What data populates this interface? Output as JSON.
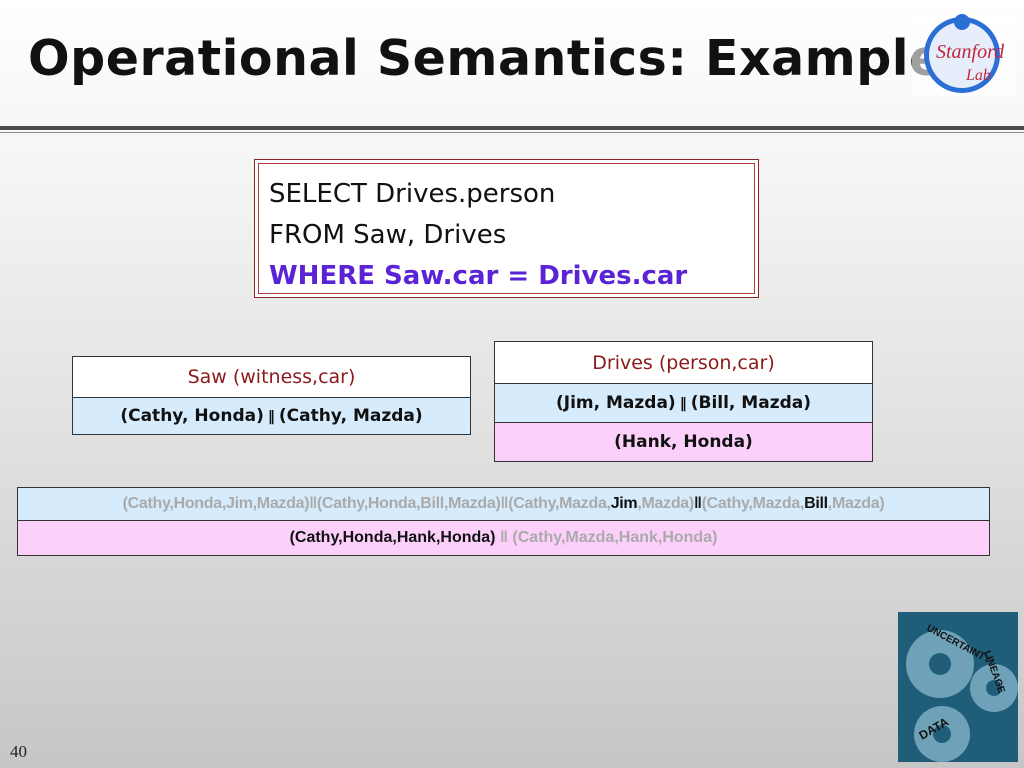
{
  "title": "Operational Semantics: Example",
  "logo": {
    "line1": "Stanford",
    "line2": "Lab"
  },
  "sql": {
    "line1": "SELECT Drives.person",
    "line2": "FROM Saw, Drives",
    "line3": "WHERE Saw.car = Drives.car"
  },
  "saw": {
    "header": "Saw (witness,car)",
    "row1_a": "(Cathy, Honda)",
    "row1_b": "(Cathy, Mazda)"
  },
  "drives": {
    "header": "Drives (person,car)",
    "row1_a": "(Jim, Mazda)",
    "row1_b": "(Bill, Mazda)",
    "row2": "(Hank, Honda)"
  },
  "separator": "‖",
  "result": {
    "row1": {
      "p1": "(Cathy,Honda,Jim,Mazda)",
      "p2": "(Cathy,Honda,Bill,Mazda)",
      "p3a": "(Cathy,Mazda,",
      "p3b": "Jim",
      "p3c": ",Mazda)",
      "p4a": "(Cathy,Mazda,",
      "p4b": "Bill",
      "p4c": ",Mazda)"
    },
    "row2": {
      "p1": "(Cathy,Honda,Hank,Honda)",
      "p2": "(Cathy,Mazda,Hank,Honda)"
    }
  },
  "gears_words": [
    "UNCERTAINTY",
    "LINEAGE",
    "DATA"
  ],
  "page_number": "40",
  "colors": {
    "title": "#111111",
    "header_text": "#8b1a1a",
    "where_clause": "#5a24d6",
    "blue_row": "#d6ecfc",
    "pink_row": "#fdd0fb",
    "faded_text": "#aaaaaa"
  }
}
